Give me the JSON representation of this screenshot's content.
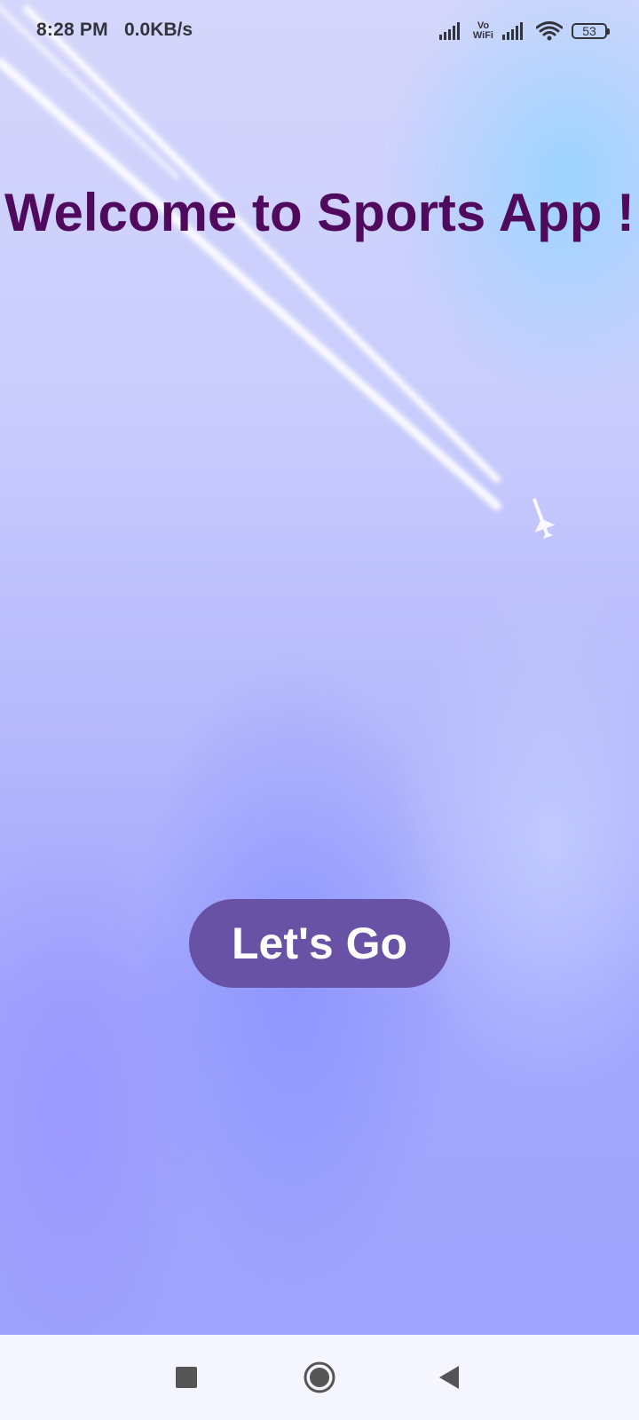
{
  "status_bar": {
    "time": "8:28 PM",
    "network_speed": "0.0KB/s",
    "vowifi_top": "Vo",
    "vowifi_bottom": "WiFi",
    "battery_level": "53",
    "icons": [
      "signal-icon",
      "vowifi-icon",
      "signal-icon",
      "wifi-icon",
      "battery-icon"
    ]
  },
  "main": {
    "title": "Welcome to Sports App !",
    "button_label": "Let's Go"
  },
  "nav_bar": {
    "icons": [
      "recents-square-icon",
      "home-circle-icon",
      "back-triangle-icon"
    ]
  },
  "colors": {
    "title": "#4f0a5d",
    "button_bg": "#6852a6",
    "button_text": "#ffffff",
    "nav_bar_bg": "#f4f5fe"
  }
}
